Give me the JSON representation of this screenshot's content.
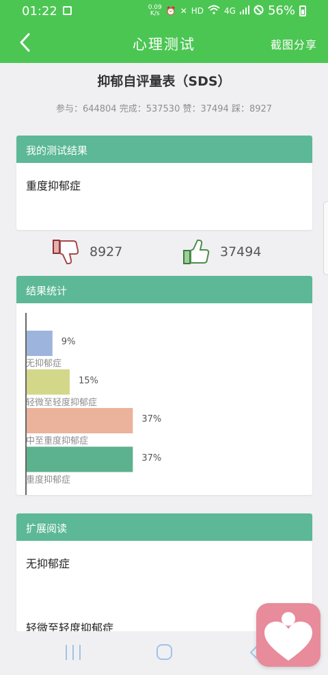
{
  "status_bar": {
    "time": "01:22",
    "network_speed_value": "0.09",
    "network_speed_unit": "K/s",
    "hd_label": "HD",
    "net_label": "4G",
    "battery": "56%"
  },
  "app_bar": {
    "title": "心理测试",
    "share_label": "截图分享"
  },
  "header": {
    "title": "抑郁自评量表（SDS）",
    "stats": "参与：644804 完成：537530 赞：37494 踩：8927"
  },
  "result_card": {
    "heading": "我的测试结果",
    "result": "重度抑郁症"
  },
  "votes": {
    "dislike_count": "8927",
    "like_count": "37494"
  },
  "chart_card": {
    "heading": "结果统计"
  },
  "chart_data": {
    "type": "bar",
    "orientation": "horizontal",
    "categories": [
      "无抑郁症",
      "轻微至轻度抑郁症",
      "中至重度抑郁症",
      "重度抑郁症"
    ],
    "values": [
      9,
      15,
      37,
      37
    ],
    "value_labels": [
      "9%",
      "15%",
      "37%",
      "37%"
    ],
    "colors": [
      "#9db5dd",
      "#d3d78a",
      "#ebb29c",
      "#5cb18e"
    ],
    "xlim": [
      0,
      100
    ]
  },
  "extended_card": {
    "heading": "扩展阅读",
    "items": [
      "无抑郁症",
      "轻微至轻度抑郁症"
    ]
  }
}
